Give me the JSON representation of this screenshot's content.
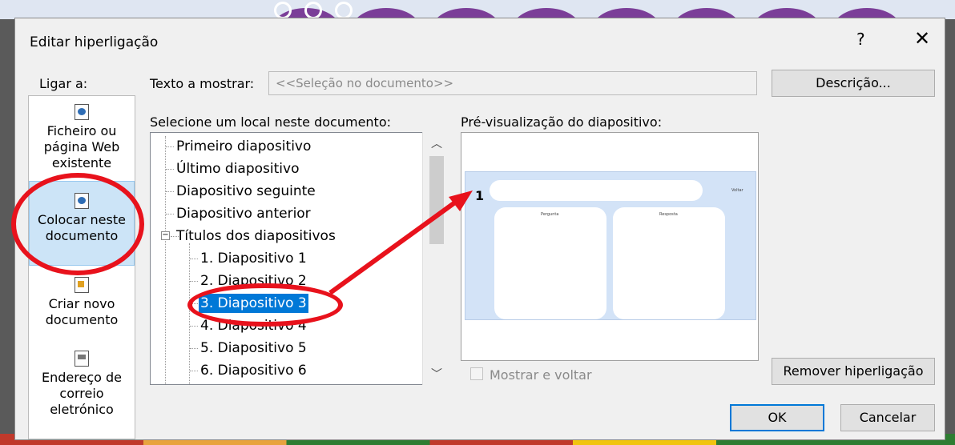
{
  "dialog": {
    "title": "Editar hiperligação",
    "help_label": "?",
    "close_label": "✕"
  },
  "link_to": {
    "label": "Ligar a:",
    "items": [
      {
        "label_lines": [
          "Ficheiro ou",
          "página Web",
          "existente"
        ],
        "icon": "web-page-icon"
      },
      {
        "label_lines": [
          "Colocar neste",
          "documento"
        ],
        "icon": "place-in-document-icon",
        "selected": true
      },
      {
        "label_lines": [
          "Criar novo",
          "documento"
        ],
        "icon": "new-document-icon"
      },
      {
        "label_lines": [
          "Endereço de",
          "correio",
          "eletrónico"
        ],
        "icon": "email-icon"
      }
    ]
  },
  "text_to_display": {
    "label": "Texto a mostrar:",
    "value": "<<Seleção no documento>>"
  },
  "buttons": {
    "description": "Descrição...",
    "remove_link": "Remover hiperligação",
    "ok": "OK",
    "cancel": "Cancelar"
  },
  "place_list": {
    "label": "Selecione um local neste documento:",
    "items": [
      "Primeiro diapositivo",
      "Último diapositivo",
      "Diapositivo seguinte",
      "Diapositivo anterior",
      "Títulos dos diapositivos",
      "1. Diapositivo 1",
      "2. Diapositivo 2",
      "3. Diapositivo 3",
      "4. Diapositivo 4",
      "5. Diapositivo 5",
      "6. Diapositivo 6"
    ],
    "selected": "3. Diapositivo 3"
  },
  "preview": {
    "label": "Pré-visualização do diapositivo:",
    "slide_number": "1",
    "slide_texts": [
      "Pergunta",
      "Resposta",
      "Voltar"
    ],
    "show_and_return_label": "Mostrar e voltar",
    "show_and_return_checked": false
  },
  "colors": {
    "annotation_red": "#e8121c",
    "selection_blue": "#0078d7"
  }
}
